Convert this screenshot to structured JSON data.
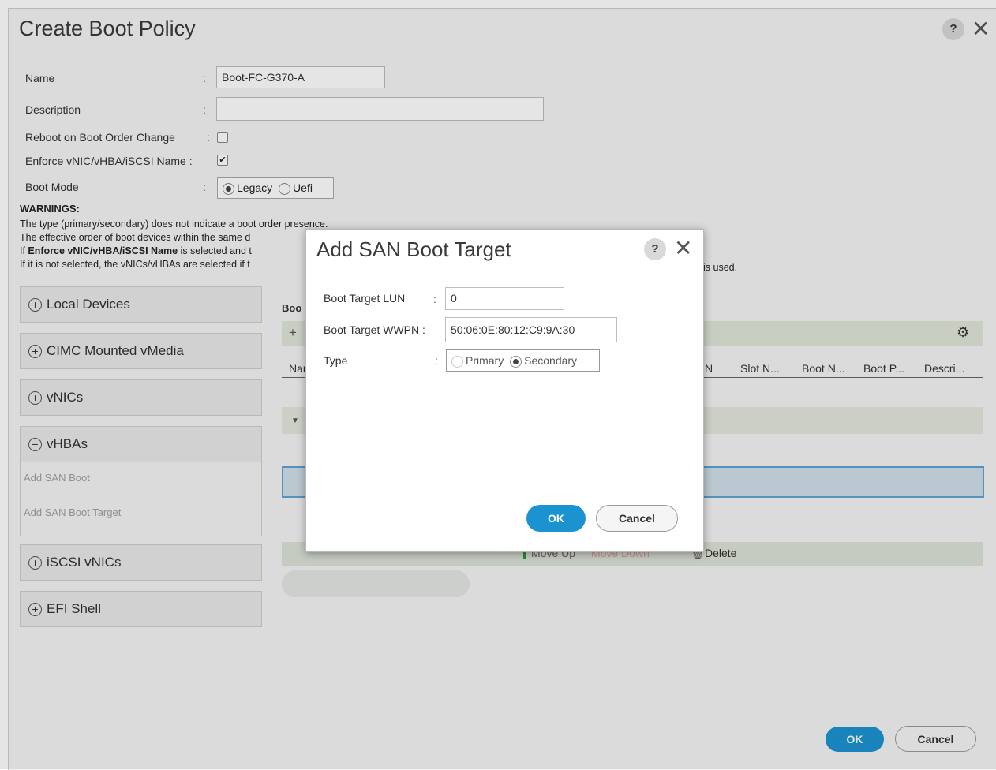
{
  "dialog": {
    "title": "Create Boot Policy",
    "help_label": "?",
    "close_label": "✕"
  },
  "form": {
    "name_label": "Name",
    "name_value": "Boot-FC-G370-A",
    "description_label": "Description",
    "description_value": "",
    "reboot_label": "Reboot on Boot Order Change",
    "reboot_checked": false,
    "enforce_label": "Enforce vNIC/vHBA/iSCSI Name",
    "enforce_checked": true,
    "bootmode_label": "Boot Mode",
    "bootmode_options": [
      "Legacy",
      "Uefi"
    ],
    "bootmode_selected": "Legacy",
    "colon": ":"
  },
  "warnings": {
    "heading": "WARNINGS:",
    "line1": "The type (primary/secondary) does not indicate a boot order presence.",
    "line2": "The effective order of boot devices within the same d",
    "line3_bold": "Enforce vNIC/vHBA/iSCSI Name",
    "line3_prefix": "If ",
    "line3_suffix": " is selected and t",
    "line4": "If it is not selected, the vNICs/vHBAs are selected if t",
    "line4_tail": "is used."
  },
  "panels": [
    {
      "label": "Local Devices",
      "expanded": false
    },
    {
      "label": "CIMC Mounted vMedia",
      "expanded": false
    },
    {
      "label": "vNICs",
      "expanded": false
    },
    {
      "label": "vHBAs",
      "expanded": true,
      "links": [
        "Add SAN Boot",
        "Add SAN Boot Target"
      ]
    },
    {
      "label": "iSCSI vNICs",
      "expanded": false
    },
    {
      "label": "EFI Shell",
      "expanded": false
    }
  ],
  "expander_collapsed": "+",
  "expander_expanded": "−",
  "grid": {
    "title_fragment": "Boo",
    "add_label": "+",
    "settings_icon": "⚙",
    "columns_visible": [
      "Nar",
      "N",
      "Slot N...",
      "Boot N...",
      "Boot P...",
      "Descri..."
    ],
    "move_up_label": "Move Up",
    "move_down_label": "Move Down",
    "delete_label": "Delete"
  },
  "footer": {
    "ok_label": "OK",
    "cancel_label": "Cancel"
  },
  "modal": {
    "title": "Add SAN Boot Target",
    "help_label": "?",
    "close_label": "✕",
    "lun_label": "Boot Target LUN",
    "lun_value": "0",
    "wwpn_label": "Boot Target WWPN",
    "wwpn_value": "50:06:0E:80:12:C9:9A:30",
    "type_label": "Type",
    "type_options": [
      "Primary",
      "Secondary"
    ],
    "type_selected": "Secondary",
    "ok_label": "OK",
    "cancel_label": "Cancel",
    "colon": ":"
  },
  "colors": {
    "accent": "#1c93d1",
    "selection": "#5fa3d3"
  }
}
